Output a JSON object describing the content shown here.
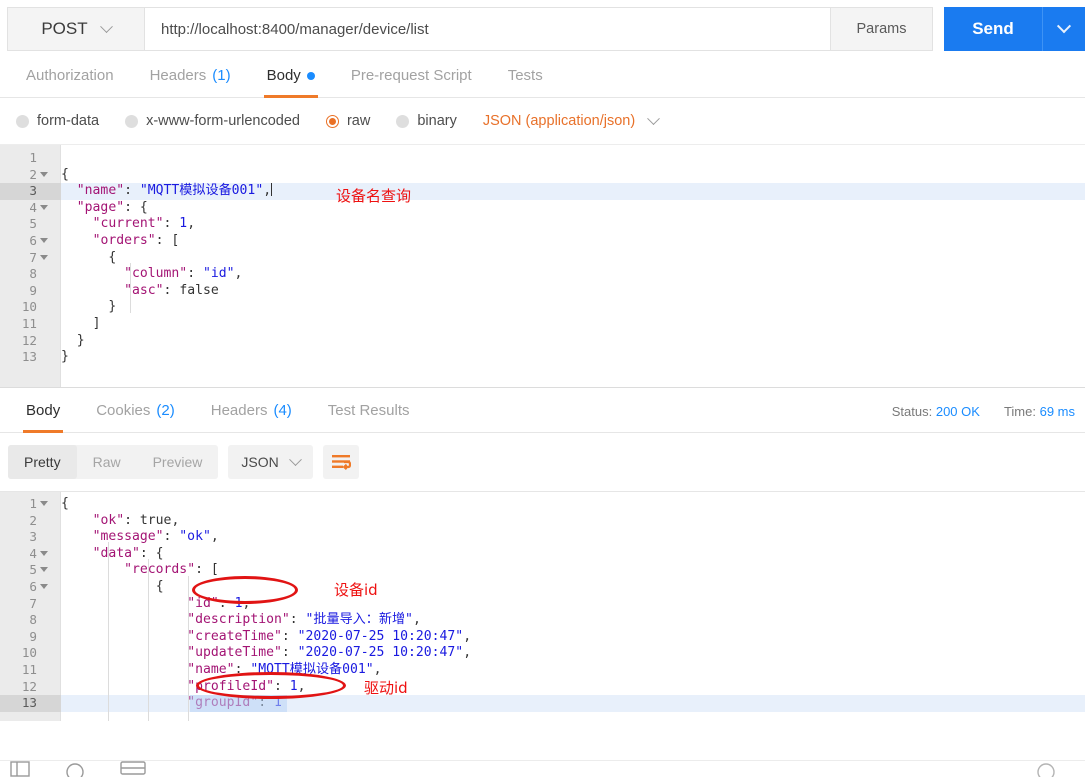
{
  "request": {
    "method": "POST",
    "url": "http://localhost:8400/manager/device/list",
    "params_label": "Params",
    "send_label": "Send",
    "tabs": [
      {
        "label": "Authorization",
        "count": "",
        "active": false,
        "dot": false
      },
      {
        "label": "Headers",
        "count": "(1)",
        "active": false,
        "dot": false
      },
      {
        "label": "Body",
        "count": "",
        "active": true,
        "dot": true
      },
      {
        "label": "Pre-request Script",
        "count": "",
        "active": false,
        "dot": false
      },
      {
        "label": "Tests",
        "count": "",
        "active": false,
        "dot": false
      }
    ],
    "body_types": [
      {
        "label": "form-data",
        "selected": false
      },
      {
        "label": "x-www-form-urlencoded",
        "selected": false
      },
      {
        "label": "raw",
        "selected": true
      },
      {
        "label": "binary",
        "selected": false
      }
    ],
    "content_type": "JSON (application/json)",
    "body_lines": [
      {
        "n": "1",
        "fold": false,
        "active": false,
        "text": ""
      },
      {
        "n": "2",
        "fold": true,
        "active": false,
        "text": "{"
      },
      {
        "n": "3",
        "fold": false,
        "active": true,
        "text": "  \"name\": \"MQTT模拟设备001\","
      },
      {
        "n": "4",
        "fold": true,
        "active": false,
        "text": "  \"page\": {"
      },
      {
        "n": "5",
        "fold": false,
        "active": false,
        "text": "    \"current\": 1,"
      },
      {
        "n": "6",
        "fold": true,
        "active": false,
        "text": "    \"orders\": ["
      },
      {
        "n": "7",
        "fold": true,
        "active": false,
        "text": "      {"
      },
      {
        "n": "8",
        "fold": false,
        "active": false,
        "text": "        \"column\": \"id\","
      },
      {
        "n": "9",
        "fold": false,
        "active": false,
        "text": "        \"asc\": false"
      },
      {
        "n": "10",
        "fold": false,
        "active": false,
        "text": "      }"
      },
      {
        "n": "11",
        "fold": false,
        "active": false,
        "text": "    ]"
      },
      {
        "n": "12",
        "fold": false,
        "active": false,
        "text": "  }"
      },
      {
        "n": "13",
        "fold": false,
        "active": false,
        "text": "}"
      }
    ],
    "annotation": "设备名查询"
  },
  "response": {
    "tabs": [
      {
        "label": "Body",
        "count": "",
        "active": true
      },
      {
        "label": "Cookies",
        "count": "(2)",
        "active": false
      },
      {
        "label": "Headers",
        "count": "(4)",
        "active": false
      },
      {
        "label": "Test Results",
        "count": "",
        "active": false
      }
    ],
    "status_label": "Status:",
    "status_value": "200 OK",
    "time_label": "Time:",
    "time_value": "69 ms",
    "view_modes": [
      {
        "label": "Pretty",
        "active": true
      },
      {
        "label": "Raw",
        "active": false
      },
      {
        "label": "Preview",
        "active": false
      }
    ],
    "format": "JSON",
    "body_lines": [
      {
        "n": "1",
        "fold": true,
        "active": false,
        "text": "{"
      },
      {
        "n": "2",
        "fold": false,
        "active": false,
        "text": "    \"ok\": true,"
      },
      {
        "n": "3",
        "fold": false,
        "active": false,
        "text": "    \"message\": \"ok\","
      },
      {
        "n": "4",
        "fold": true,
        "active": false,
        "text": "    \"data\": {"
      },
      {
        "n": "5",
        "fold": true,
        "active": false,
        "text": "        \"records\": ["
      },
      {
        "n": "6",
        "fold": true,
        "active": false,
        "text": "            {"
      },
      {
        "n": "7",
        "fold": false,
        "active": false,
        "text": "                \"id\": 1,"
      },
      {
        "n": "8",
        "fold": false,
        "active": false,
        "text": "                \"description\": \"批量导入：新增\","
      },
      {
        "n": "9",
        "fold": false,
        "active": false,
        "text": "                \"createTime\": \"2020-07-25 10:20:47\","
      },
      {
        "n": "10",
        "fold": false,
        "active": false,
        "text": "                \"updateTime\": \"2020-07-25 10:20:47\","
      },
      {
        "n": "11",
        "fold": false,
        "active": false,
        "text": "                \"name\": \"MQTT模拟设备001\","
      },
      {
        "n": "12",
        "fold": false,
        "active": false,
        "text": "                \"profileId\": 1,"
      },
      {
        "n": "13",
        "fold": false,
        "active": true,
        "text": "                \"groupId\": 1"
      }
    ],
    "annotation_id": "设备id",
    "annotation_profile": "驱动id"
  },
  "colors": {
    "accent_orange": "#ef7a29",
    "accent_blue": "#1a7bf0",
    "annotation_red": "#ee1111",
    "json_key": "#a31474",
    "json_string": "#1a1ae0"
  }
}
